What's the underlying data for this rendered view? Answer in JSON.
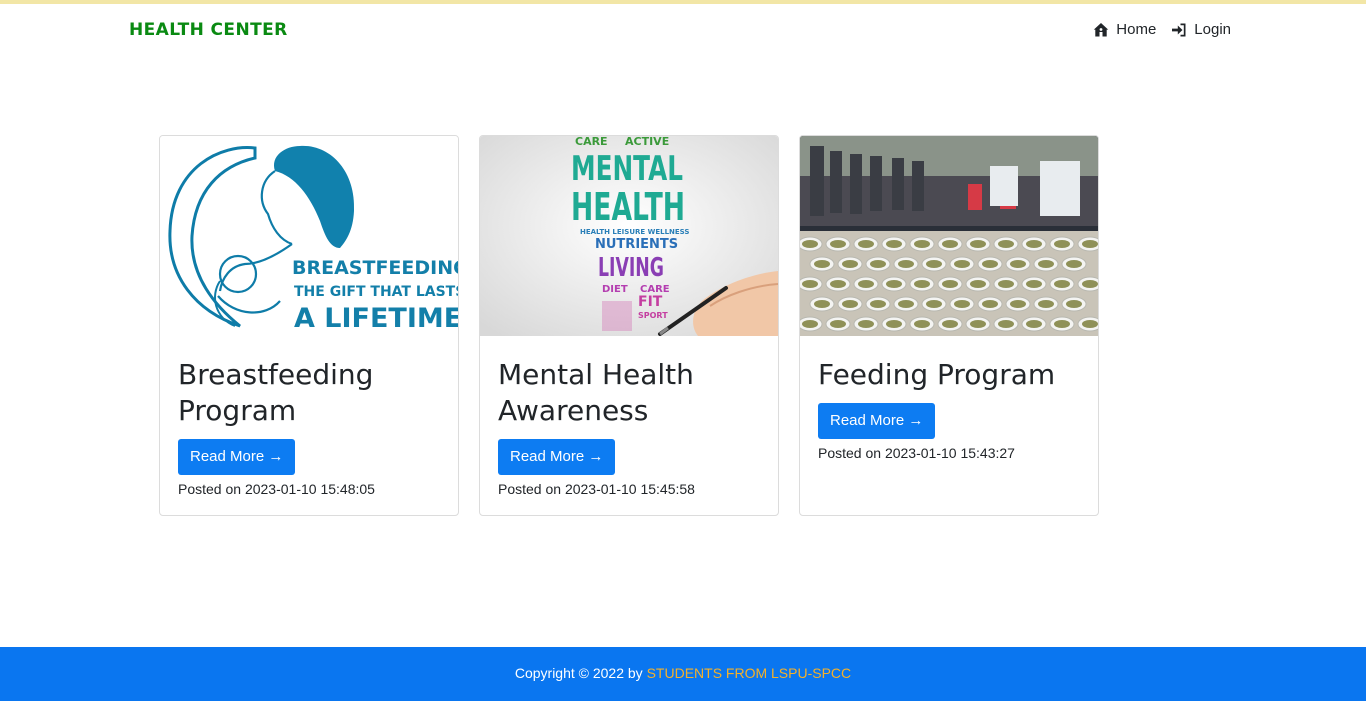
{
  "navbar": {
    "brand": "HEALTH CENTER",
    "links": [
      {
        "label": "Home",
        "icon": "home-icon"
      },
      {
        "label": "Login",
        "icon": "login-icon"
      }
    ]
  },
  "cards": [
    {
      "title": "Breastfeeding Program",
      "button": "Read More →",
      "posted": "Posted on 2023-01-10 15:48:05",
      "image": "breastfeeding-illustration",
      "image_text": [
        "BREASTFEEDING:",
        "THE GIFT THAT LASTS",
        "A LIFETIME"
      ]
    },
    {
      "title": "Mental Health Awareness",
      "button": "Read More →",
      "posted": "Posted on 2023-01-10 15:45:58",
      "image": "mental-health-word-cloud",
      "image_text": [
        "CARE",
        "ACTIVE",
        "MENTAL",
        "HEALTH",
        "HEALTH LEISURE WELLNESS",
        "NUTRIENTS",
        "LIVING",
        "DIET",
        "CARE",
        "FIT",
        "SPORT"
      ]
    },
    {
      "title": "Feeding Program",
      "button": "Read More →",
      "posted": "Posted on 2023-01-10 15:43:27",
      "image": "feeding-program-photo"
    }
  ],
  "footer": {
    "prefix": "Copyright © 2022 by ",
    "link": "STUDENTS FROM LSPU-SPCC"
  },
  "colors": {
    "brand": "#0a8a12",
    "primary": "#0d7cf2",
    "footer_bg": "#0a76f0",
    "footer_link": "#f5b12a"
  }
}
